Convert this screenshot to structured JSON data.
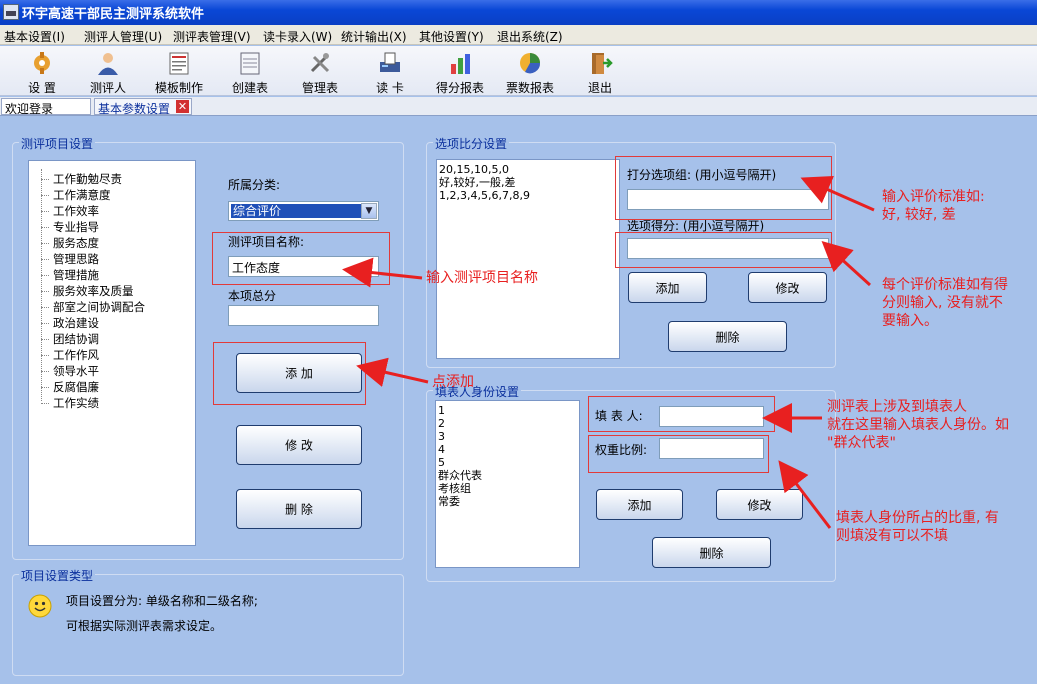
{
  "window": {
    "title": "环宇高速干部民主测评系统软件"
  },
  "menu": [
    "基本设置(I)",
    "测评人管理(U)",
    "测评表管理(V)",
    "读卡录入(W)",
    "统计输出(X)",
    "其他设置(Y)",
    "退出系统(Z)"
  ],
  "toolbar": [
    {
      "label": "设    置",
      "icon": "settings-icon"
    },
    {
      "label": "测评人",
      "icon": "person-icon"
    },
    {
      "label": "模板制作",
      "icon": "template-icon"
    },
    {
      "label": "创建表",
      "icon": "create-table-icon"
    },
    {
      "label": "管理表",
      "icon": "tools-icon"
    },
    {
      "label": "读  卡",
      "icon": "card-reader-icon"
    },
    {
      "label": "得分报表",
      "icon": "score-report-icon"
    },
    {
      "label": "票数报表",
      "icon": "vote-report-icon"
    },
    {
      "label": "退出",
      "icon": "exit-door-icon"
    }
  ],
  "tabs": {
    "welcome": "欢迎登录",
    "basic": "基本参数设置"
  },
  "project": {
    "title": "测评项目设置",
    "items": [
      "工作勤勉尽责",
      "工作满意度",
      "工作效率",
      "专业指导",
      "服务态度",
      "管理思路",
      "管理措施",
      "服务效率及质量",
      "部室之间协调配合",
      "政治建设",
      "团结协调",
      "工作作风",
      "领导水平",
      "反腐倡廉",
      "工作实绩"
    ],
    "category_label": "所属分类:",
    "category_value": "综合评价",
    "name_label": "测评项目名称:",
    "name_value": "工作态度",
    "total_label": "本项总分",
    "total_value": "",
    "add": "添  加",
    "edit": "修  改",
    "del": "删  除"
  },
  "options": {
    "title": "选项比分设置",
    "list": [
      "20,15,10,5,0",
      "好,较好,一般,差",
      "1,2,3,4,5,6,7,8,9"
    ],
    "group_label": "打分选项组: (用小逗号隔开)",
    "score_label": "选项得分: (用小逗号隔开)",
    "add": "添加",
    "edit": "修改",
    "del": "删除"
  },
  "filler": {
    "title": "填表人身份设置",
    "list": [
      "1",
      "2",
      "3",
      "4",
      "5",
      "群众代表",
      "考核组",
      "常委"
    ],
    "person_label": "填 表 人:",
    "weight_label": "权重比例:",
    "add": "添加",
    "edit": "修改",
    "del": "删除"
  },
  "type_group": {
    "title": "项目设置类型",
    "line1": "项目设置分为: 单级名称和二级名称;",
    "line2": "可根据实际测评表需求设定。"
  },
  "annotations": {
    "a1": "输入测评项目名称",
    "a2": "点添加",
    "a3": [
      "输入评价标准如:",
      "好, 较好, 差"
    ],
    "a4": [
      "每个评价标准如有得",
      "分则输入, 没有就不",
      "要输入。"
    ],
    "a5": [
      "测评表上涉及到填表人",
      "就在这里输入填表人身份。如",
      "\"群众代表\""
    ],
    "a6": [
      "填表人身份所占的比重, 有",
      "则填没有可以不填"
    ]
  },
  "colors": {
    "accent": "#0a47d6",
    "panel_bg": "#a6c1ea",
    "annotation_red": "#e82020"
  }
}
